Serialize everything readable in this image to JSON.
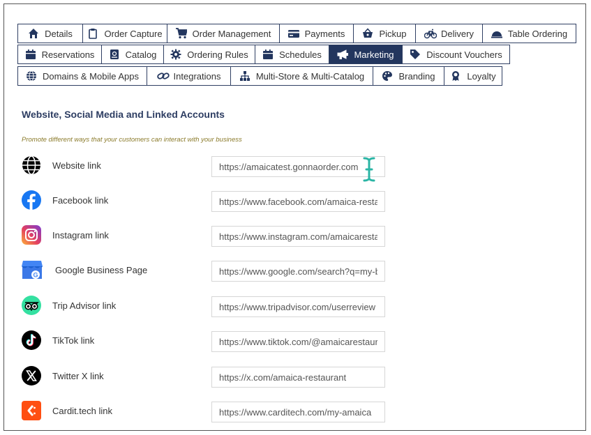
{
  "tabs": {
    "row1": [
      {
        "label": "Details",
        "icon": "home-icon"
      },
      {
        "label": "Order Capture",
        "icon": "clipboard-icon"
      },
      {
        "label": "Order Management",
        "icon": "cart-icon"
      },
      {
        "label": "Payments",
        "icon": "credit-card-icon"
      },
      {
        "label": "Pickup",
        "icon": "basket-icon"
      },
      {
        "label": "Delivery",
        "icon": "bicycle-icon"
      },
      {
        "label": "Table Ordering",
        "icon": "cloche-icon"
      }
    ],
    "row2": [
      {
        "label": "Reservations",
        "icon": "calendar-icon"
      },
      {
        "label": "Catalog",
        "icon": "book-icon"
      },
      {
        "label": "Ordering Rules",
        "icon": "gear-icon"
      },
      {
        "label": "Schedules",
        "icon": "calendar-icon"
      },
      {
        "label": "Marketing",
        "icon": "megaphone-icon",
        "active": true
      },
      {
        "label": "Discount Vouchers",
        "icon": "tags-icon"
      }
    ],
    "row3": [
      {
        "label": "Domains & Mobile Apps",
        "icon": "globe-icon"
      },
      {
        "label": "Integrations",
        "icon": "link-icon"
      },
      {
        "label": "Multi-Store & Multi-Catalog",
        "icon": "sitemap-icon"
      },
      {
        "label": "Branding",
        "icon": "palette-icon"
      },
      {
        "label": "Loyalty",
        "icon": "award-icon"
      }
    ]
  },
  "section": {
    "title": "Website, Social Media and Linked Accounts",
    "subtitle": "Promote different ways that your customers can interact with your business"
  },
  "links": [
    {
      "label": "Website link",
      "value": "https://amaicatest.gonnaorder.com",
      "icon": "globe-icon"
    },
    {
      "label": "Facebook link",
      "value": "https://www.facebook.com/amaica-restaurant",
      "icon": "facebook-icon"
    },
    {
      "label": "Instagram link",
      "value": "https://www.instagram.com/amaicarestaurant",
      "icon": "instagram-icon"
    },
    {
      "label": "Google Business Page",
      "value": "https://www.google.com/search?q=my-business",
      "icon": "google-business-icon"
    },
    {
      "label": "Trip Advisor link",
      "value": "https://www.tripadvisor.com/userreview",
      "icon": "tripadvisor-icon"
    },
    {
      "label": "TikTok link",
      "value": "https://www.tiktok.com/@amaicarestaurant",
      "icon": "tiktok-icon"
    },
    {
      "label": "Twitter X link",
      "value": "https://x.com/amaica-restaurant",
      "icon": "x-icon"
    },
    {
      "label": "Cardit.tech link",
      "value": "https://www.carditech.com/my-amaica",
      "icon": "cardit-icon"
    }
  ],
  "colors": {
    "tab_border": "#2f3f63",
    "tab_active_bg": "#23365e",
    "title": "#2d3d62",
    "subtitle": "#8a7a2a",
    "cursor": "#2bb5a5"
  }
}
